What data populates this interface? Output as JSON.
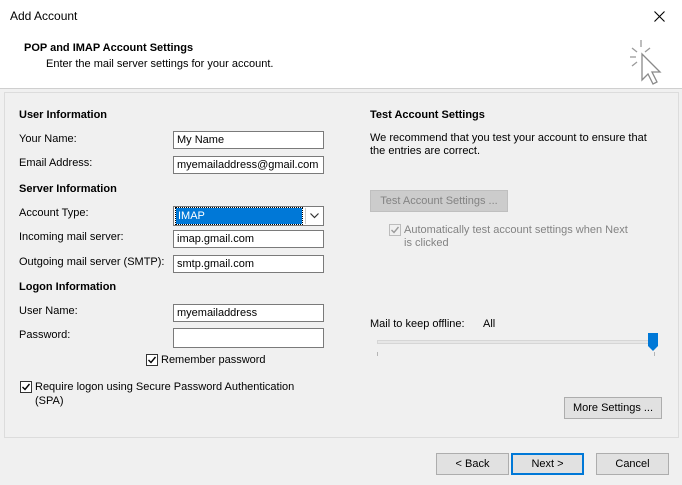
{
  "window": {
    "title": "Add Account"
  },
  "header": {
    "title": "POP and IMAP Account Settings",
    "subtitle": "Enter the mail server settings for your account."
  },
  "user_info": {
    "heading": "User Information",
    "name_label": "Your Name:",
    "name_value": "My Name",
    "email_label": "Email Address:",
    "email_value": "myemailaddress@gmail.com"
  },
  "server_info": {
    "heading": "Server Information",
    "account_type_label": "Account Type:",
    "account_type_value": "IMAP",
    "incoming_label": "Incoming mail server:",
    "incoming_value": "imap.gmail.com",
    "outgoing_label": "Outgoing mail server (SMTP):",
    "outgoing_value": "smtp.gmail.com"
  },
  "logon_info": {
    "heading": "Logon Information",
    "username_label": "User Name:",
    "username_value": "myemailaddress",
    "password_label": "Password:",
    "password_value": "",
    "remember_label": "Remember password",
    "remember_checked": true,
    "spa_label_line1": "Require logon using Secure Password Authentication",
    "spa_label_line2": "(SPA)",
    "spa_checked": true
  },
  "test_settings": {
    "heading": "Test Account Settings",
    "desc_line1": "We recommend that you test your account to ensure that",
    "desc_line2": "the entries are correct.",
    "test_button": "Test Account Settings ...",
    "auto_test_line1": "Automatically test account settings when Next",
    "auto_test_line2": "is clicked",
    "auto_test_checked": true
  },
  "offline": {
    "label": "Mail to keep offline:",
    "value": "All",
    "slider_fraction": 1.0
  },
  "more_settings_button": "More Settings ...",
  "footer": {
    "back": "< Back",
    "next": "Next >",
    "cancel": "Cancel"
  },
  "colors": {
    "accent": "#0078d7",
    "background": "#f0f0f0"
  }
}
